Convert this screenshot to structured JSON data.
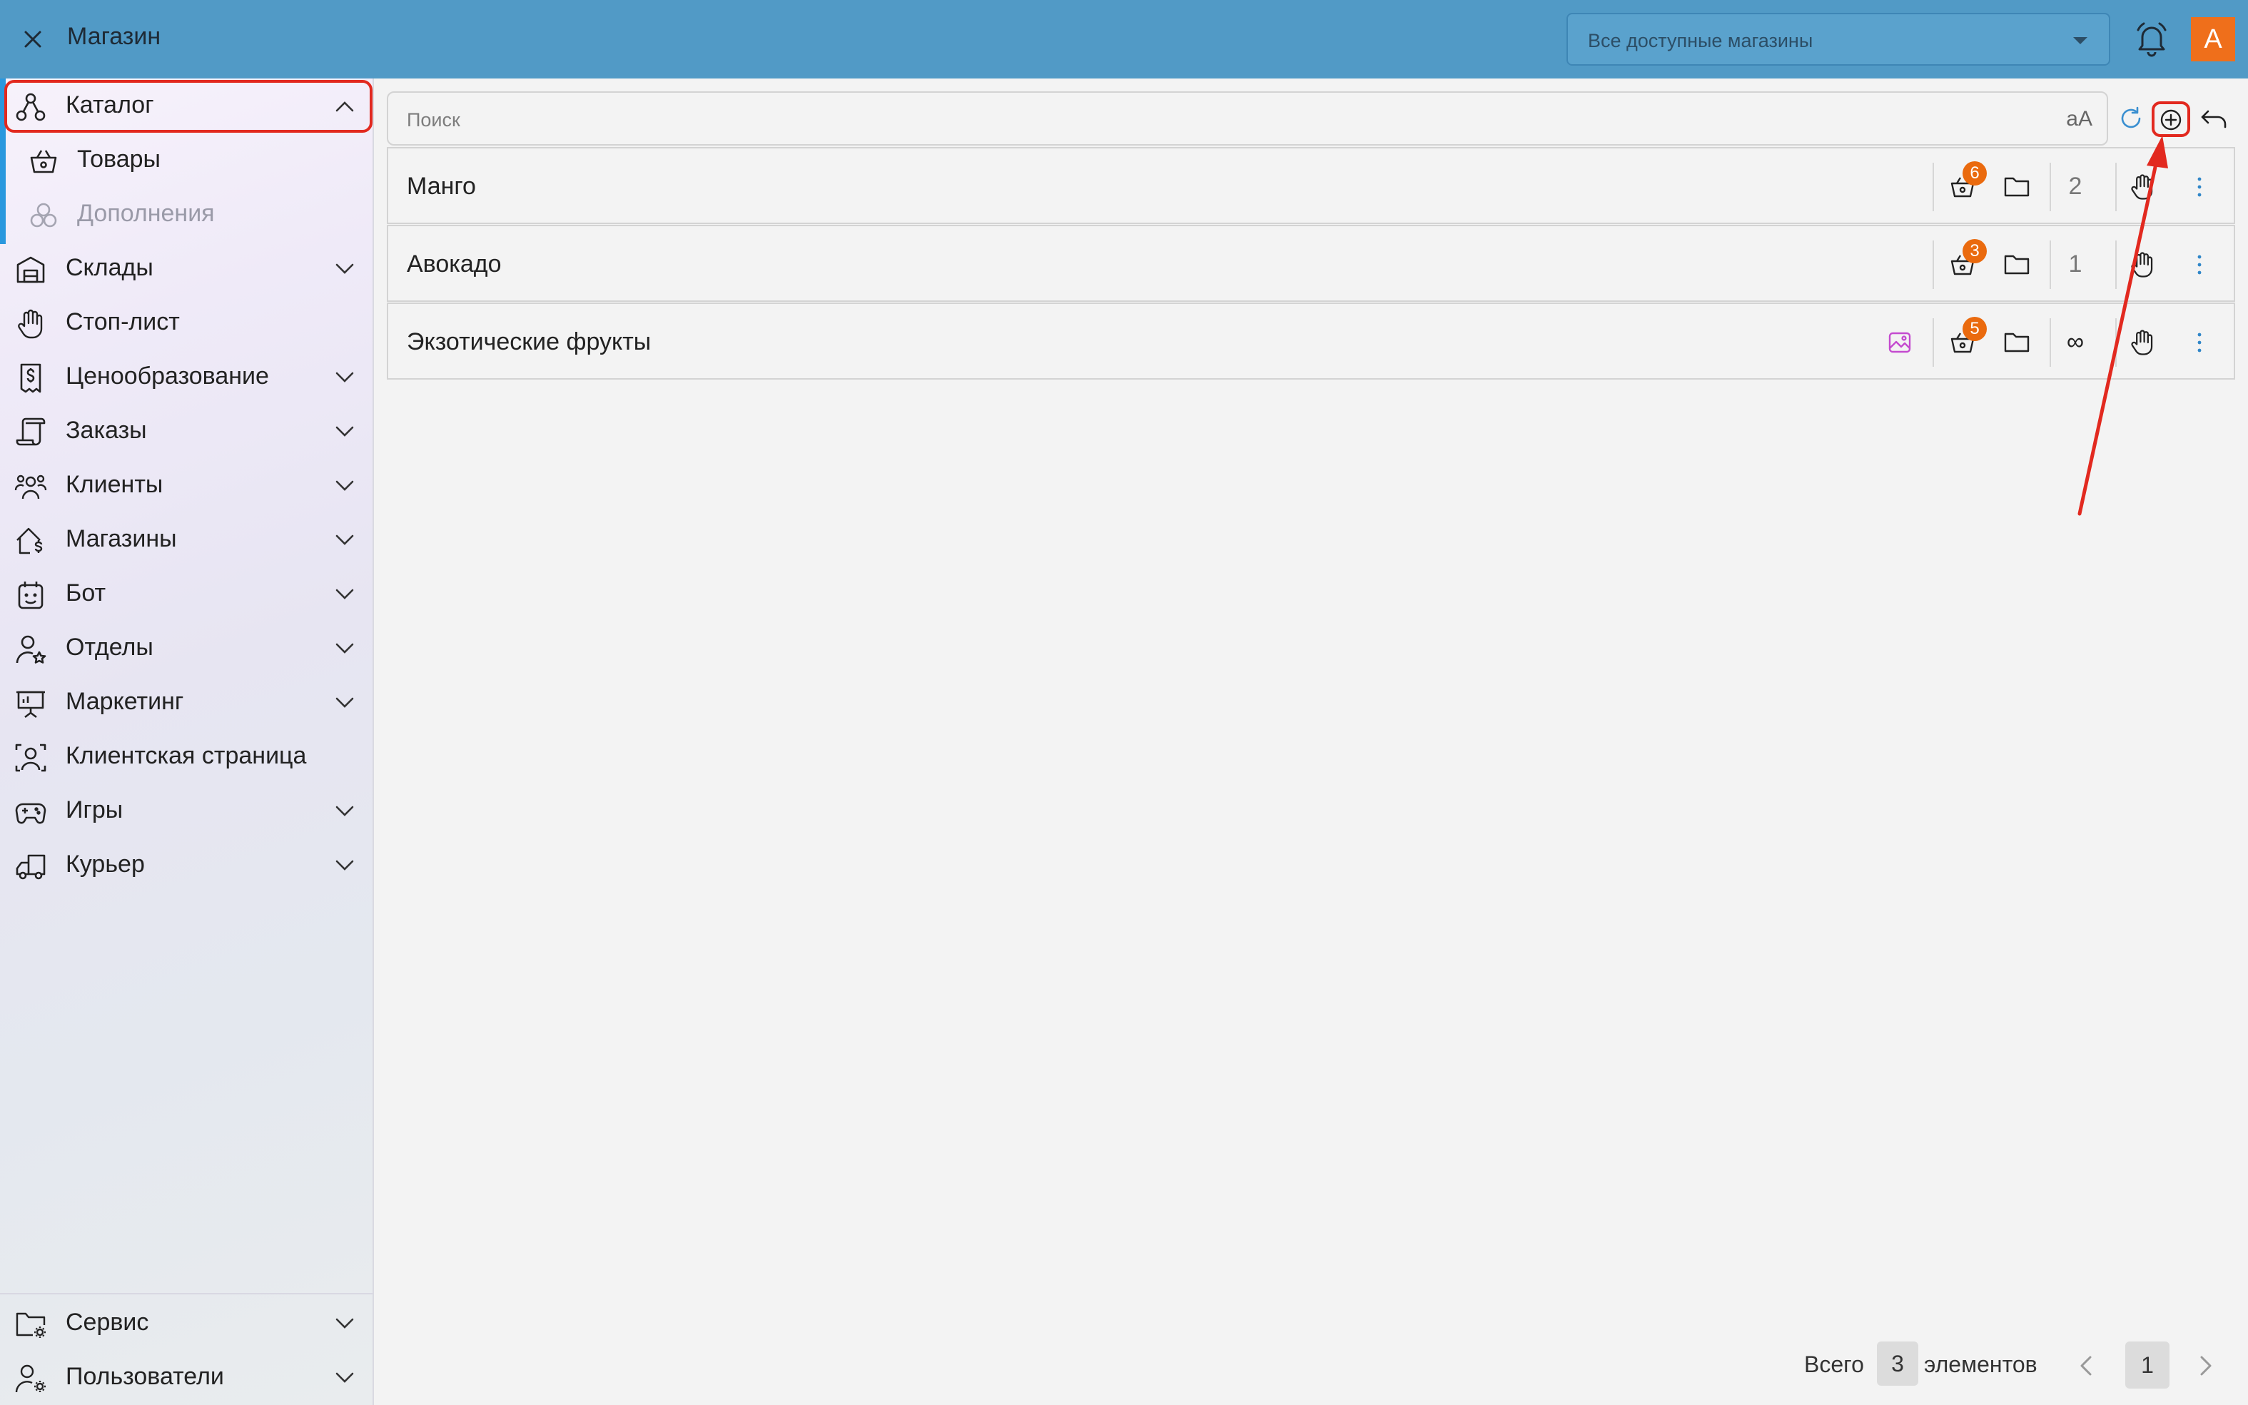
{
  "header": {
    "title": "Магазин",
    "store_selector_value": "Все доступные магазины",
    "avatar_letter": "А"
  },
  "sidebar": {
    "items": [
      {
        "label": "Каталог",
        "icon": "catalog-icon",
        "expanded": true,
        "highlighted": true
      },
      {
        "label": "Товары",
        "icon": "basket-icon",
        "sub": true
      },
      {
        "label": "Дополнения",
        "icon": "addons-icon",
        "sub": true,
        "disabled": true
      },
      {
        "label": "Склады",
        "icon": "warehouse-icon"
      },
      {
        "label": "Стоп-лист",
        "icon": "hand-icon"
      },
      {
        "label": "Ценообразование",
        "icon": "receipt-icon"
      },
      {
        "label": "Заказы",
        "icon": "scroll-icon"
      },
      {
        "label": "Клиенты",
        "icon": "users-icon"
      },
      {
        "label": "Магазины",
        "icon": "store-icon"
      },
      {
        "label": "Бот",
        "icon": "bot-icon"
      },
      {
        "label": "Отделы",
        "icon": "user-star-icon"
      },
      {
        "label": "Маркетинг",
        "icon": "presentation-icon"
      },
      {
        "label": "Клиентская страница",
        "icon": "client-page-icon"
      },
      {
        "label": "Игры",
        "icon": "gamepad-icon"
      },
      {
        "label": "Курьер",
        "icon": "truck-icon"
      }
    ],
    "bottom_items": [
      {
        "label": "Сервис",
        "icon": "folder-gear-icon"
      },
      {
        "label": "Пользователи",
        "icon": "user-gear-icon"
      }
    ]
  },
  "search": {
    "placeholder": "Поиск",
    "case_toggle": "aA"
  },
  "rows": [
    {
      "name": "Манго",
      "products_badge": "6",
      "count": "2",
      "has_image_icon": false
    },
    {
      "name": "Авокадо",
      "products_badge": "3",
      "count": "1",
      "has_image_icon": false
    },
    {
      "name": "Экзотические фрукты",
      "products_badge": "5",
      "count": "∞",
      "has_image_icon": true
    }
  ],
  "footer": {
    "total_prefix": "Всего",
    "total_count": "3",
    "total_suffix": "элементов",
    "current_page": "1"
  },
  "colors": {
    "header_bg": "#519ac6",
    "accent": "#2a98de",
    "badge": "#ea6a0e",
    "avatar": "#ef6f1b",
    "annotation": "#e2291f",
    "image_icon": "#c44bcf"
  }
}
